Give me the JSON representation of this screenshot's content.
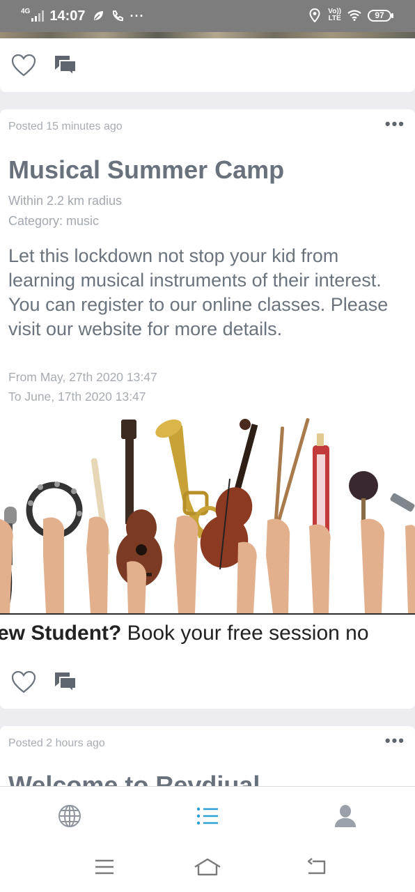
{
  "status_bar": {
    "network": "4G",
    "time": "14:07",
    "overflow": "···",
    "volte_top": "Vo))",
    "volte_bottom": "LTE",
    "battery": "97",
    "icons": [
      "signal-icon",
      "leaf-icon",
      "phone-icon",
      "location-icon",
      "wifi-icon",
      "battery-icon"
    ]
  },
  "previous_post": {
    "actions": [
      "heart-icon",
      "comment-icon"
    ]
  },
  "post": {
    "posted": "Posted 15 minutes ago",
    "title": "Musical Summer Camp",
    "radius": "Within 2.2 km radius",
    "category": "Category: music",
    "body": "Let this lockdown not stop your kid from learning musical instruments of their interest. You can register to our online classes. Please visit our website for more details.",
    "from": "From May, 27th 2020 13:47",
    "to": "To June, 17th 2020 13:47",
    "banner": {
      "caption_bold": "ew Student?",
      "caption_rest": " Book your free session no"
    },
    "actions": [
      "heart-icon",
      "comment-icon"
    ]
  },
  "next_post": {
    "posted": "Posted 2 hours ago",
    "title": "Welcome to Revdiual"
  },
  "tabs": [
    {
      "name": "globe-icon",
      "active": false
    },
    {
      "name": "list-icon",
      "active": true
    },
    {
      "name": "profile-icon",
      "active": false
    }
  ],
  "colors": {
    "accent": "#2a9fd8",
    "text": "#6b737d",
    "muted": "#a7acb3",
    "background": "#edecf1"
  }
}
